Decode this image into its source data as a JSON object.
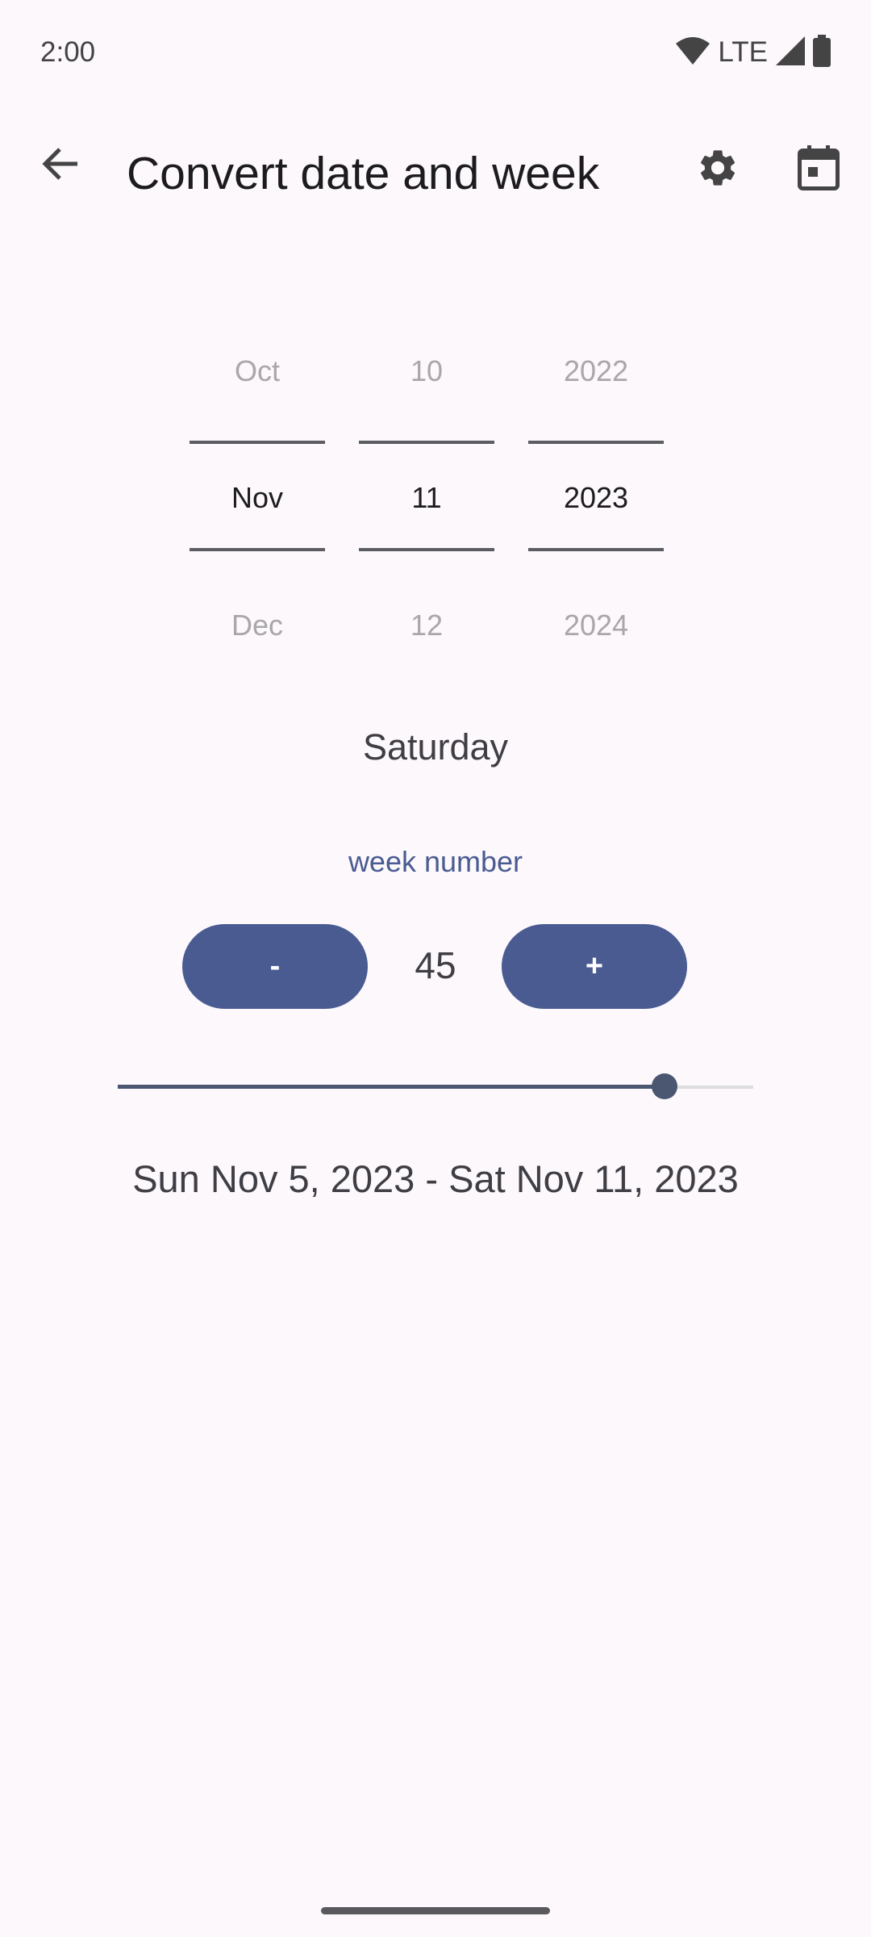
{
  "status_bar": {
    "time": "2:00",
    "network": "LTE"
  },
  "toolbar": {
    "title": "Convert date and week",
    "back_icon": "arrow-back-icon",
    "settings_icon": "gear-icon",
    "calendar_icon": "calendar-icon"
  },
  "pickers": {
    "month": {
      "prev": "Oct",
      "current": "Nov",
      "next": "Dec"
    },
    "day": {
      "prev": "10",
      "current": "11",
      "next": "12"
    },
    "year": {
      "prev": "2022",
      "current": "2023",
      "next": "2024"
    }
  },
  "weekday": "Saturday",
  "week": {
    "label": "week number",
    "value": "45",
    "minus_label": "-",
    "plus_label": "+",
    "slider_fraction": 0.86
  },
  "range_text": "Sun Nov 5, 2023 - Sat Nov 11, 2023",
  "colors": {
    "accent": "#4a5b91",
    "background": "#fcf8fc"
  }
}
